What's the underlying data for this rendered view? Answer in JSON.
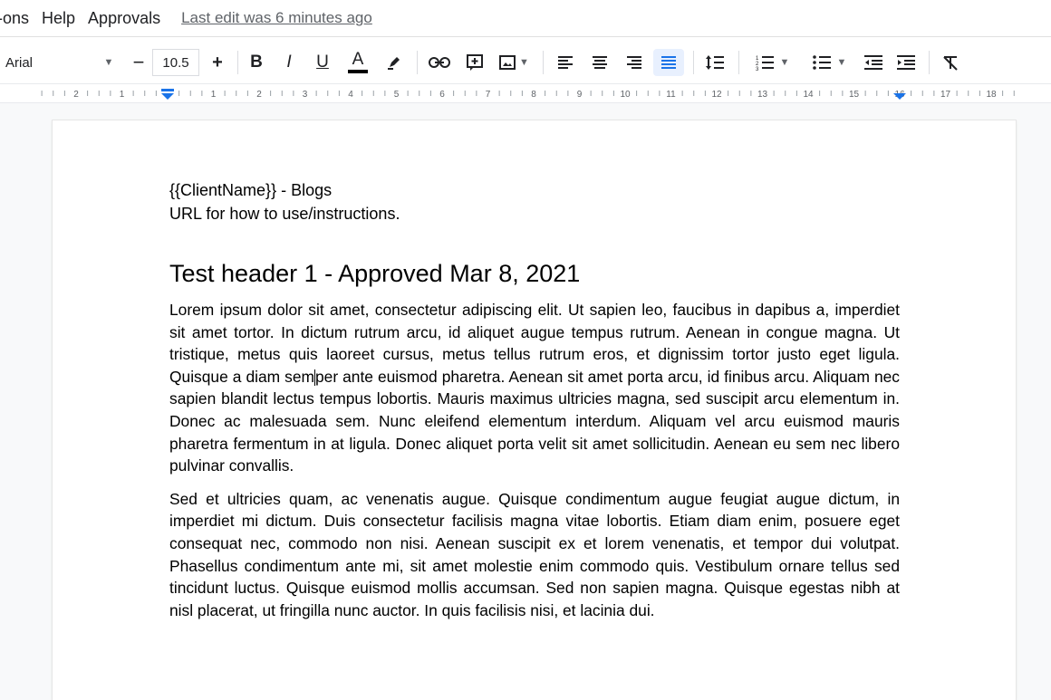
{
  "menu": {
    "items": [
      "l-ons",
      "Help",
      "Approvals"
    ],
    "last_edit": "Last edit was 6 minutes ago"
  },
  "toolbar": {
    "font_name": "Arial",
    "font_size": "10.5",
    "decrease_label": "−",
    "increase_label": "+",
    "bold_label": "B",
    "italic_label": "I",
    "underline_label": "U",
    "text_color_label": "A",
    "text_color": "#000000",
    "active_align": "justify",
    "accent": "#1a73e8"
  },
  "ruler": {
    "left_labels": [
      "2",
      "1"
    ],
    "right_labels": [
      "1",
      "2",
      "3",
      "4",
      "5",
      "6",
      "7",
      "8",
      "9",
      "10",
      "11",
      "12",
      "13",
      "14",
      "15",
      "16",
      "17",
      "18"
    ]
  },
  "document": {
    "line1": "{{ClientName}} - Blogs",
    "line2": "URL for how to use/instructions.",
    "heading": "Test header 1 - Approved Mar 8, 2021",
    "para1_before_cursor": "Lorem ipsum dolor sit amet, consectetur adipiscing elit. Ut sapien leo, faucibus in dapibus a, imperdiet sit amet tortor. In dictum rutrum arcu, id aliquet augue tempus rutrum. Aenean in congue magna. Ut tristique, metus quis laoreet cursus, metus tellus rutrum eros, et dignissim tortor justo eget ligula. Quisque a diam sem",
    "para1_after_cursor": "per ante euismod pharetra. Aenean sit amet porta arcu, id finibus arcu. Aliquam nec sapien blandit lectus tempus lobortis. Mauris maximus ultricies magna, sed suscipit arcu elementum in. Donec ac malesuada sem. Nunc eleifend elementum interdum. Aliquam vel arcu euismod mauris pharetra fermentum in at ligula. Donec aliquet porta velit sit amet sollicitudin. Aenean eu sem nec libero pulvinar convallis.",
    "para2": "Sed et ultricies quam, ac venenatis augue. Quisque condimentum augue feugiat augue dictum, in imperdiet mi dictum. Duis consectetur facilisis magna vitae lobortis. Etiam diam enim, posuere eget consequat nec, commodo non nisi. Aenean suscipit ex et lorem venenatis, et tempor dui volutpat. Phasellus condimentum ante mi, sit amet molestie enim commodo quis. Vestibulum ornare tellus sed tincidunt luctus. Quisque euismod mollis accumsan. Sed non sapien magna. Quisque egestas nibh at nisl placerat, ut fringilla nunc auctor. In quis facilisis nisi, et lacinia dui."
  }
}
